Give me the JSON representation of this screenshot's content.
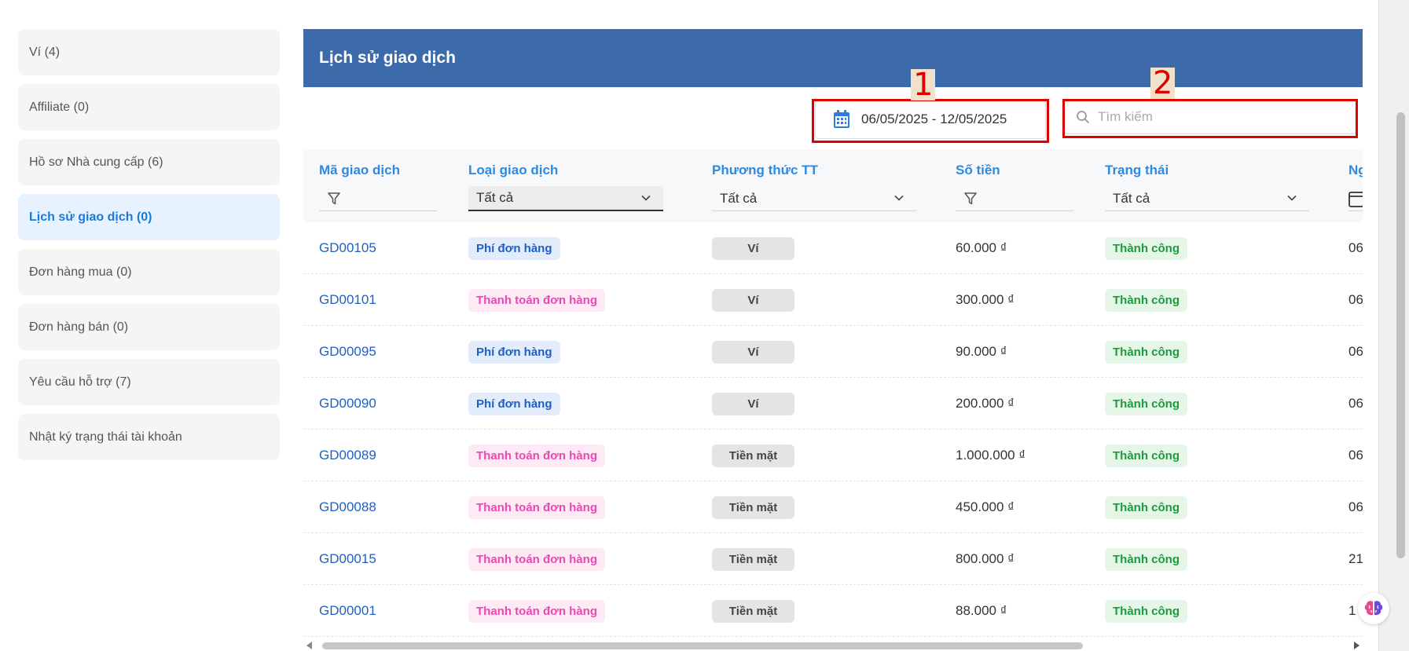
{
  "sidebar": {
    "items": [
      {
        "label": "Ví (4)",
        "active": false
      },
      {
        "label": "Affiliate (0)",
        "active": false
      },
      {
        "label": "Hồ sơ Nhà cung cấp (6)",
        "active": false
      },
      {
        "label": "Lịch sử giao dịch (0)",
        "active": true
      },
      {
        "label": "Đơn hàng mua (0)",
        "active": false
      },
      {
        "label": "Đơn hàng bán (0)",
        "active": false
      },
      {
        "label": "Yêu cầu hỗ trợ (7)",
        "active": false
      },
      {
        "label": "Nhật ký trạng thái tài khoản",
        "active": false
      }
    ]
  },
  "panel": {
    "title": "Lịch sử giao dịch"
  },
  "toolbar": {
    "date_range": "06/05/2025 - 12/05/2025",
    "search_placeholder": "Tìm kiếm",
    "search_value": ""
  },
  "annotations": {
    "label_1": "1",
    "label_2": "2"
  },
  "table": {
    "columns": [
      {
        "label": "Mã giao dịch",
        "filter": "funnel"
      },
      {
        "label": "Loại giao dịch",
        "filter": "select",
        "value": "Tất cả"
      },
      {
        "label": "Phương thức TT",
        "filter": "select",
        "value": "Tất cả"
      },
      {
        "label": "Số tiền",
        "filter": "funnel"
      },
      {
        "label": "Trạng thái",
        "filter": "select",
        "value": "Tất cả"
      },
      {
        "label": "Ng",
        "filter": "calendar"
      }
    ],
    "rows": [
      {
        "id": "GD00105",
        "type": "Phí đơn hàng",
        "type_kind": "fee",
        "method": "Ví",
        "amount": "60.000 ₫",
        "status": "Thành công",
        "date": "06"
      },
      {
        "id": "GD00101",
        "type": "Thanh toán đơn hàng",
        "type_kind": "pay",
        "method": "Ví",
        "amount": "300.000 ₫",
        "status": "Thành công",
        "date": "06"
      },
      {
        "id": "GD00095",
        "type": "Phí đơn hàng",
        "type_kind": "fee",
        "method": "Ví",
        "amount": "90.000 ₫",
        "status": "Thành công",
        "date": "06"
      },
      {
        "id": "GD00090",
        "type": "Phí đơn hàng",
        "type_kind": "fee",
        "method": "Ví",
        "amount": "200.000 ₫",
        "status": "Thành công",
        "date": "06"
      },
      {
        "id": "GD00089",
        "type": "Thanh toán đơn hàng",
        "type_kind": "pay",
        "method": "Tiền mặt",
        "amount": "1.000.000 ₫",
        "status": "Thành công",
        "date": "06"
      },
      {
        "id": "GD00088",
        "type": "Thanh toán đơn hàng",
        "type_kind": "pay",
        "method": "Tiền mặt",
        "amount": "450.000 ₫",
        "status": "Thành công",
        "date": "06"
      },
      {
        "id": "GD00015",
        "type": "Thanh toán đơn hàng",
        "type_kind": "pay",
        "method": "Tiền mặt",
        "amount": "800.000 ₫",
        "status": "Thành công",
        "date": "21"
      },
      {
        "id": "GD00001",
        "type": "Thanh toán đơn hàng",
        "type_kind": "pay",
        "method": "Tiền mặt",
        "amount": "88.000 ₫",
        "status": "Thành công",
        "date": "1"
      }
    ]
  },
  "colors": {
    "header_bg": "#3d6aa8",
    "accent": "#2b8ae6",
    "annotation": "#e00000"
  }
}
